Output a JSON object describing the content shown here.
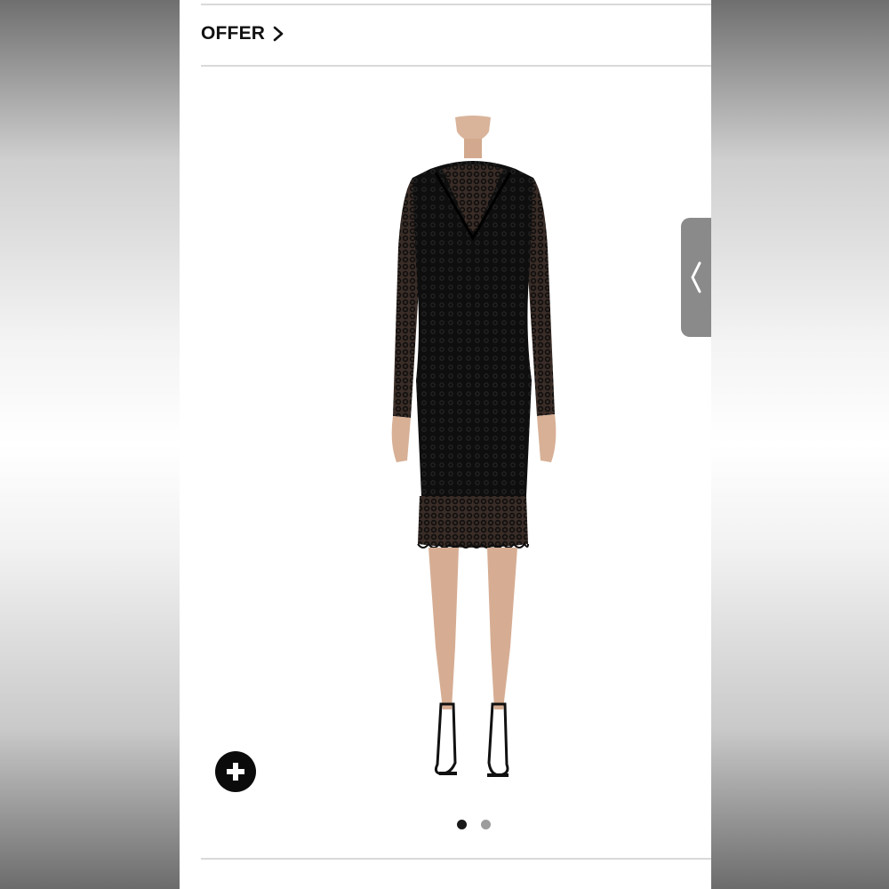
{
  "header": {
    "offer_label": "OFFER",
    "offer_icon": "chevron-right-icon"
  },
  "product": {
    "image_icon": "dress-photo",
    "zoom_icon": "plus-icon"
  },
  "carousel": {
    "total_slides": 2,
    "active_slide": 1
  },
  "side_tab": {
    "icon": "chevron-left-icon"
  },
  "colors": {
    "accent": "#0b0b0b",
    "dot_active": "#1a1a1a",
    "dot_inactive": "#9c9c9c",
    "tab": "#8a8a8a"
  }
}
